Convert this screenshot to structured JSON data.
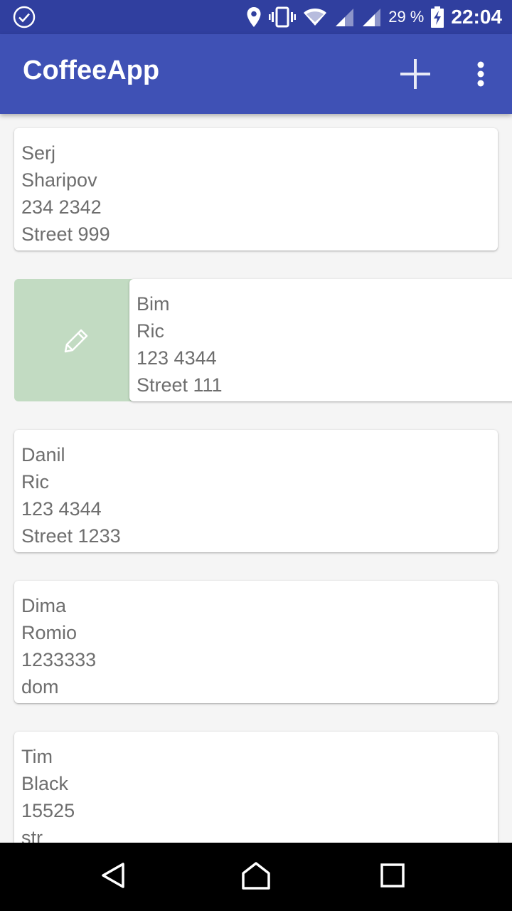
{
  "status_bar": {
    "battery_percent": "29 %",
    "time": "22:04",
    "icons": [
      "check-circle-icon",
      "location-icon",
      "vibrate-icon",
      "wifi-icon",
      "signal-icon",
      "signal-icon",
      "battery-charging-icon"
    ]
  },
  "app_bar": {
    "title": "CoffeeApp",
    "actions": [
      "add-icon",
      "more-vert-icon"
    ]
  },
  "colors": {
    "status_bar": "#303f9f",
    "app_bar": "#3f51b5",
    "swipe_background": "#c2dbc2",
    "card_text": "#6e6e6e",
    "list_background": "#f5f5f5"
  },
  "contacts": [
    {
      "first_name": "Serj",
      "last_name": "Sharipov",
      "phone": "234 2342",
      "address": "Street 999"
    },
    {
      "first_name": "Bim",
      "last_name": "Ric",
      "phone": "123 4344",
      "address": "Street 111",
      "swipe_action_icon": "edit-icon"
    },
    {
      "first_name": "Danil",
      "last_name": "Ric",
      "phone": "123 4344",
      "address": "Street 1233"
    },
    {
      "first_name": "Dima",
      "last_name": "Romio",
      "phone": "1233333",
      "address": "dom"
    },
    {
      "first_name": "Tim",
      "last_name": "Black",
      "phone": "15525",
      "address": "str"
    }
  ],
  "nav_bar": {
    "buttons": [
      "back-icon",
      "home-icon",
      "recents-icon"
    ]
  }
}
